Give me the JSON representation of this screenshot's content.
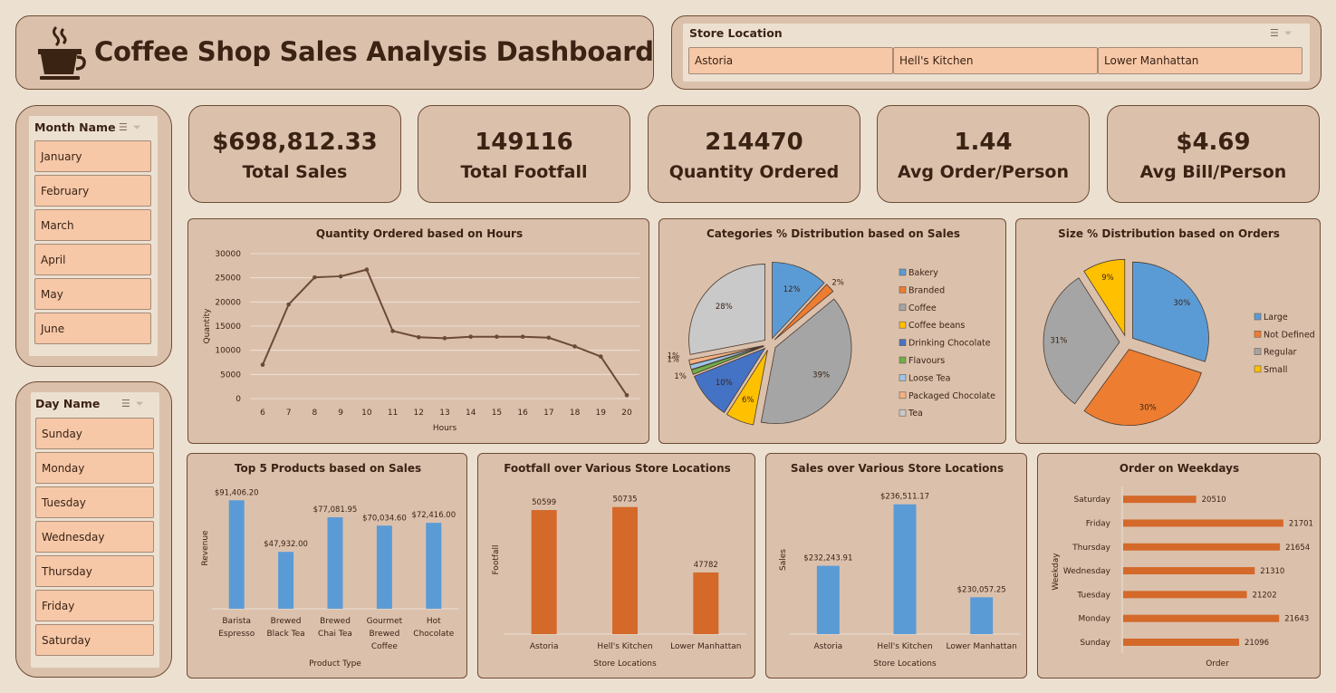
{
  "title": "Coffee Shop Sales Analysis Dashboard",
  "store_slicer": {
    "header": "Store Location",
    "items": [
      "Astoria",
      "Hell's Kitchen",
      "Lower Manhattan"
    ]
  },
  "month_slicer": {
    "header": "Month Name",
    "items": [
      "January",
      "February",
      "March",
      "April",
      "May",
      "June"
    ]
  },
  "day_slicer": {
    "header": "Day Name",
    "items": [
      "Sunday",
      "Monday",
      "Tuesday",
      "Wednesday",
      "Thursday",
      "Friday",
      "Saturday"
    ]
  },
  "kpis": [
    {
      "value": "$698,812.33",
      "label": "Total Sales"
    },
    {
      "value": "149116",
      "label": "Total Footfall"
    },
    {
      "value": "214470",
      "label": "Quantity Ordered"
    },
    {
      "value": "1.44",
      "label": "Avg Order/Person"
    },
    {
      "value": "$4.69",
      "label": "Avg Bill/Person"
    }
  ],
  "colors": {
    "background": "#ece0d1",
    "panel": "#dbc1ac",
    "border": "#6e4b33",
    "chip": "#f6c8a8",
    "line": "#6b4a36",
    "blue": "#5b9bd5",
    "orange": "#d4692a"
  },
  "icons": {
    "logo": "coffee-cup-icon",
    "multi_select": "multi-select-icon",
    "clear_filter": "clear-filter-icon"
  },
  "chart_data": [
    {
      "type": "line",
      "title": "Quantity Ordered based on Hours",
      "xlabel": "Hours",
      "ylabel": "Quantity",
      "x": [
        6,
        7,
        8,
        9,
        10,
        11,
        12,
        13,
        14,
        15,
        16,
        17,
        18,
        19,
        20
      ],
      "values": [
        7000,
        19500,
        25100,
        25300,
        26700,
        14000,
        12700,
        12500,
        12800,
        12800,
        12800,
        12600,
        10800,
        8700,
        700
      ],
      "ylim": [
        0,
        30000
      ],
      "yticks": [
        0,
        5000,
        10000,
        15000,
        20000,
        25000,
        30000
      ],
      "grid": true
    },
    {
      "type": "pie",
      "title": "Categories % Distribution based on Sales",
      "legend_position": "right",
      "slices": [
        {
          "label": "Bakery",
          "value": 12,
          "display": "12%",
          "color": "#5b9bd5"
        },
        {
          "label": "Branded",
          "value": 2,
          "display": "2%",
          "color": "#ed7d31"
        },
        {
          "label": "Coffee",
          "value": 39,
          "display": "39%",
          "color": "#a5a5a5"
        },
        {
          "label": "Coffee beans",
          "value": 6,
          "display": "6%",
          "color": "#ffc000"
        },
        {
          "label": "Drinking Chocolate",
          "value": 10,
          "display": "10%",
          "color": "#4472c4"
        },
        {
          "label": "Flavours",
          "value": 1,
          "display": "1%",
          "color": "#70ad47"
        },
        {
          "label": "Loose Tea",
          "value": 1,
          "display": "1%",
          "color": "#9dc3e6"
        },
        {
          "label": "Packaged Chocolate",
          "value": 1,
          "display": "1%",
          "color": "#f4b183"
        },
        {
          "label": "Tea",
          "value": 28,
          "display": "28%",
          "color": "#c9c9c9"
        }
      ]
    },
    {
      "type": "pie",
      "title": "Size % Distribution based on Orders",
      "legend_position": "right",
      "slices": [
        {
          "label": "Large",
          "value": 30,
          "display": "30%",
          "color": "#5b9bd5"
        },
        {
          "label": "Not Defined",
          "value": 30,
          "display": "30%",
          "color": "#ed7d31"
        },
        {
          "label": "Regular",
          "value": 31,
          "display": "31%",
          "color": "#a5a5a5"
        },
        {
          "label": "Small",
          "value": 9,
          "display": "9%",
          "color": "#ffc000"
        }
      ]
    },
    {
      "type": "bar",
      "title": "Top 5 Products based on Sales",
      "xlabel": "Product Type",
      "ylabel": "Revenue",
      "categories": [
        "Barista Espresso",
        "Brewed Black Tea",
        "Brewed Chai Tea",
        "Gourmet Brewed Coffee",
        "Hot Chocolate"
      ],
      "values": [
        91406.2,
        47932.0,
        77081.95,
        70034.6,
        72416.0
      ],
      "labels": [
        "$91,406.20",
        "$47,932.00",
        "$77,081.95",
        "$70,034.60",
        "$72,416.00"
      ],
      "ylim": [
        0,
        100000
      ],
      "color": "#5b9bd5"
    },
    {
      "type": "bar",
      "title": "Footfall over Various Store Locations",
      "xlabel": "Store Locations",
      "ylabel": "Footfall",
      "categories": [
        "Astoria",
        "Hell's Kitchen",
        "Lower Manhattan"
      ],
      "values": [
        50599,
        50735,
        47782
      ],
      "labels": [
        "50599",
        "50735",
        "47782"
      ],
      "ylim": [
        45000,
        51500
      ],
      "color": "#d4692a"
    },
    {
      "type": "bar",
      "title": "Sales over Various Store Locations",
      "xlabel": "Store Locations",
      "ylabel": "Sales",
      "categories": [
        "Astoria",
        "Hell's Kitchen",
        "Lower Manhattan"
      ],
      "values": [
        232243.91,
        236511.17,
        230057.25
      ],
      "labels": [
        "$232,243.91",
        "$236,511.17",
        "$230,057.25"
      ],
      "ylim": [
        227500,
        237500
      ],
      "color": "#5b9bd5"
    },
    {
      "type": "bar",
      "orientation": "horizontal",
      "title": "Order on Weekdays",
      "xlabel": "Order",
      "ylabel": "Weekday",
      "categories": [
        "Saturday",
        "Friday",
        "Thursday",
        "Wednesday",
        "Tuesday",
        "Monday",
        "Sunday"
      ],
      "values": [
        20510,
        21701,
        21654,
        21310,
        21202,
        21643,
        21096
      ],
      "labels": [
        "20510",
        "21701",
        "21654",
        "21310",
        "21202",
        "21643",
        "21096"
      ],
      "xlim": [
        19500,
        21900
      ],
      "color": "#d4692a"
    }
  ]
}
